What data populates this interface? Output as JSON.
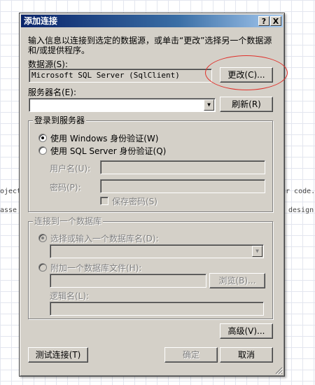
{
  "background": {
    "left_text_1": "oject",
    "left_text_2": "asse",
    "right_text_1": "ur code.",
    "right_text_2": "design"
  },
  "dialog": {
    "title": "添加连接",
    "help_button": "?",
    "close_button": "X",
    "description": "输入信息以连接到选定的数据源，或单击“更改”选择另一个数据源和/或提供程序。",
    "datasource_label": "数据源(S):",
    "datasource_value": "Microsoft SQL Server (SqlClient)",
    "change_button": "更改(C)...",
    "server_label": "服务器名(E):",
    "server_value": "",
    "refresh_button": "刷新(R)",
    "login_group": {
      "title": "登录到服务器",
      "windows_auth": "使用 Windows 身份验证(W)",
      "sql_auth": "使用 SQL Server 身份验证(Q)",
      "selected": "windows_auth",
      "username_label": "用户名(U):",
      "password_label": "密码(P):",
      "save_password": "保存密码(S)"
    },
    "database_group": {
      "title": "连接到一个数据库",
      "select_db": "选择或输入一个数据库名(D):",
      "attach_db": "附加一个数据库文件(H):",
      "browse_button": "浏览(B)...",
      "logical_name_label": "逻辑名(L):"
    },
    "advanced_button": "高级(V)...",
    "test_button": "测试连接(T)",
    "ok_button": "确定",
    "cancel_button": "取消"
  },
  "colors": {
    "annotation": "#e0302a",
    "title_start": "#0a246a",
    "title_end": "#a6caf0"
  }
}
